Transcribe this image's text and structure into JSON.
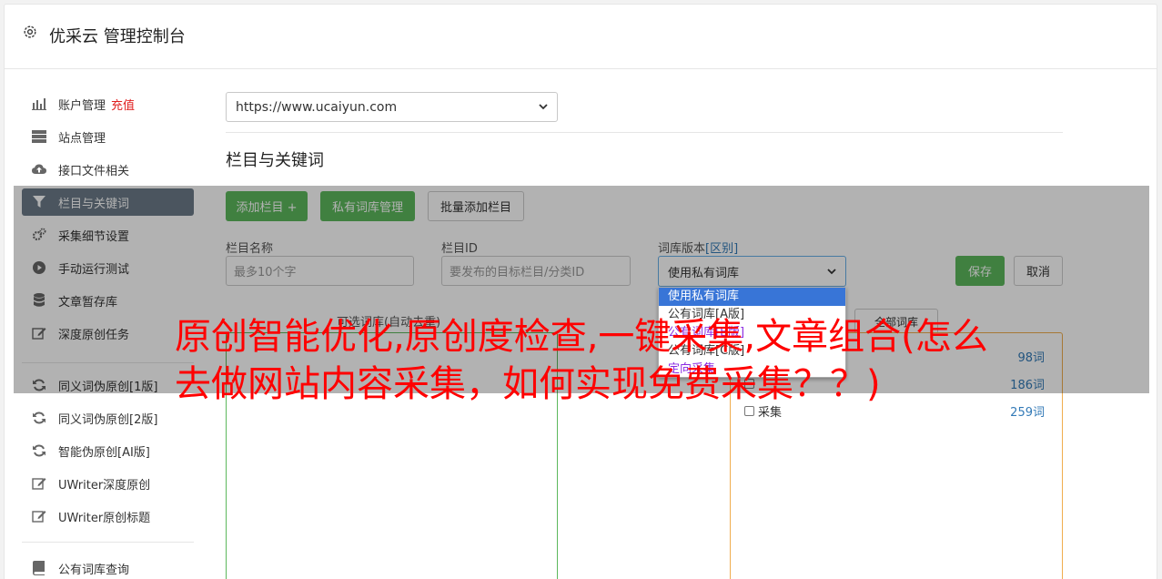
{
  "app": {
    "title": "优采云 管理控制台"
  },
  "sidebar": {
    "group1": [
      {
        "label": "账户管理",
        "extra": "充值",
        "icon": "bar-chart-icon"
      },
      {
        "label": "站点管理",
        "icon": "server-icon"
      },
      {
        "label": "接口文件相关",
        "icon": "cloud-upload-icon"
      },
      {
        "label": "栏目与关键词",
        "icon": "filter-icon",
        "active": true
      },
      {
        "label": "采集细节设置",
        "icon": "gears-icon"
      },
      {
        "label": "手动运行测试",
        "icon": "play-circle-icon"
      },
      {
        "label": "文章暂存库",
        "icon": "database-icon"
      },
      {
        "label": "深度原创任务",
        "icon": "edit-icon"
      }
    ],
    "group2": [
      {
        "label": "同义词伪原创[1版]",
        "icon": "refresh-icon"
      },
      {
        "label": "同义词伪原创[2版]",
        "icon": "refresh-icon"
      },
      {
        "label": "智能伪原创[AI版]",
        "icon": "refresh-icon"
      },
      {
        "label": "UWriter深度原创",
        "icon": "edit-icon"
      },
      {
        "label": "UWriter原创标题",
        "icon": "edit-icon"
      }
    ],
    "group3": [
      {
        "label": "公有词库查询",
        "icon": "book-icon"
      }
    ]
  },
  "main": {
    "site_select": "https://www.ucaiyun.com",
    "section_title": "栏目与关键词",
    "buttons": {
      "add": "添加栏目 +",
      "private_lib": "私有词库管理",
      "batch_add": "批量添加栏目"
    },
    "form": {
      "name_label": "栏目名称",
      "name_placeholder": "最多10个字",
      "id_label": "栏目ID",
      "id_placeholder": "要发布的目标栏目/分类ID",
      "version_label": "词库版本",
      "version_link": "[区别]",
      "version_value": "使用私有词库",
      "save": "保存",
      "cancel": "取消"
    },
    "box_label": "可选词库(自动去重)",
    "all_button": "全部词库",
    "keywords": [
      {
        "label": "",
        "count": "98词"
      },
      {
        "label": "",
        "count": "186词"
      },
      {
        "label": "采集",
        "count": "259词"
      }
    ],
    "dropdown_options": [
      {
        "label": "使用私有词库",
        "selected": true
      },
      {
        "label": "公有词库[A版]"
      },
      {
        "label": "公有词库[B版]",
        "purple": true
      },
      {
        "label": "公有词库[C版]"
      },
      {
        "label": "定向采集",
        "purple": true
      }
    ]
  },
  "headline": "原创智能优化,原创度检查,一键采集,文章组合(怎么去做网站内容采集，如何实现免费采集？？)"
}
